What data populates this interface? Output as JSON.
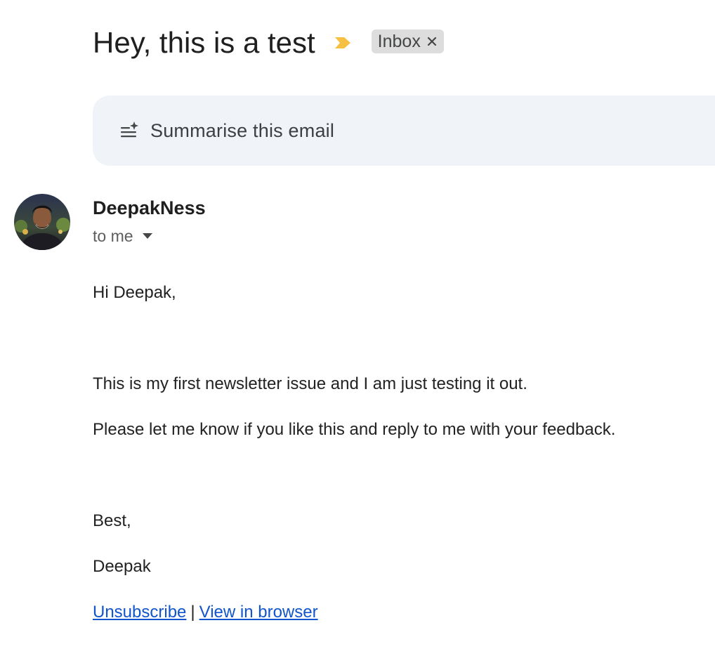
{
  "email": {
    "subject": "Hey, this is a test",
    "label": "Inbox",
    "summary_button": "Summarise this email",
    "sender": {
      "name": "DeepakNess",
      "recipient": "to me"
    },
    "body": {
      "greeting": "Hi Deepak,",
      "paragraph_1": "This is my first newsletter issue and I am just testing it out.",
      "paragraph_2": "Please let me know if you like this and reply to me with your feedback.",
      "signoff": "Best,",
      "signature": "Deepak"
    },
    "footer": {
      "unsubscribe": "Unsubscribe",
      "separator": "|",
      "view_in_browser": "View in browser"
    }
  },
  "icons": {
    "importance": "importance-marker-icon",
    "label_close": "close-icon",
    "summary": "summarize-sparkle-icon",
    "recipient_details": "caret-down-icon"
  },
  "colors": {
    "importance_marker": "#f6c142",
    "summary_card_bg": "#f0f4f9",
    "label_chip_bg": "#dddddd",
    "link": "#1155cc"
  }
}
